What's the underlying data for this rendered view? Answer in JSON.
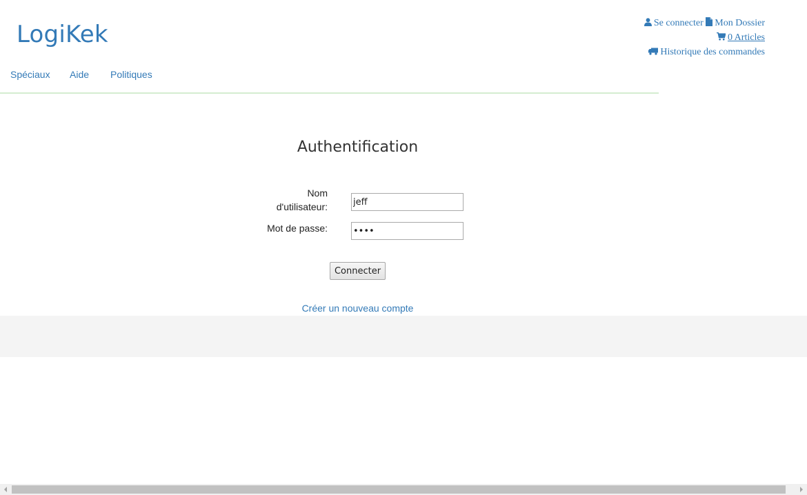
{
  "brand": {
    "name": "LogiKek"
  },
  "user_links": {
    "login": "Se connecter",
    "account": "Mon Dossier",
    "cart": "0 Articles",
    "orders": "Historique des commandes"
  },
  "nav": {
    "items": [
      "Spéciaux",
      "Aide",
      "Politiques"
    ]
  },
  "auth": {
    "title": "Authentification",
    "username_label_line1": "Nom",
    "username_label_line2": "d'utilisateur:",
    "username_value": "jeff",
    "password_label": "Mot de passe:",
    "password_value": "••••",
    "submit_label": "Connecter",
    "create_account": "Créer un nouveau compte"
  },
  "colors": {
    "link": "#337ab7",
    "nav_border": "#d4ecd0",
    "footer_bg": "#f4f4f4"
  },
  "icons": {
    "login": "user-icon",
    "account": "file-icon",
    "cart": "cart-icon",
    "orders": "truck-icon"
  }
}
